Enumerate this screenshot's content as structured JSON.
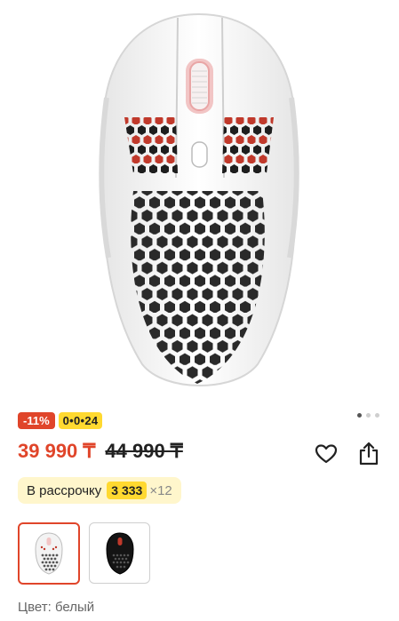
{
  "product": {
    "image": "white-wireless-gaming-mouse-hexagon-shell",
    "gallery_indicator": {
      "total": 3,
      "active": 1
    }
  },
  "badges": {
    "discount": "-11%",
    "installment_plan": "0•0•24"
  },
  "price": {
    "current": "39 990 ₸",
    "old": "44 990 ₸"
  },
  "actions": {
    "favorite_icon": "heart-icon",
    "share_icon": "share-icon"
  },
  "installment": {
    "label": "В рассрочку",
    "amount": "3 333",
    "months": "×12"
  },
  "variants": [
    {
      "name": "white-mouse-variant",
      "selected": true
    },
    {
      "name": "black-mouse-variant",
      "selected": false
    }
  ],
  "color": {
    "text": "Цвет: белый"
  },
  "colors": {
    "accent": "#e0452a",
    "badge_yellow": "#ffd930",
    "installment_bg": "#fff6cc"
  }
}
